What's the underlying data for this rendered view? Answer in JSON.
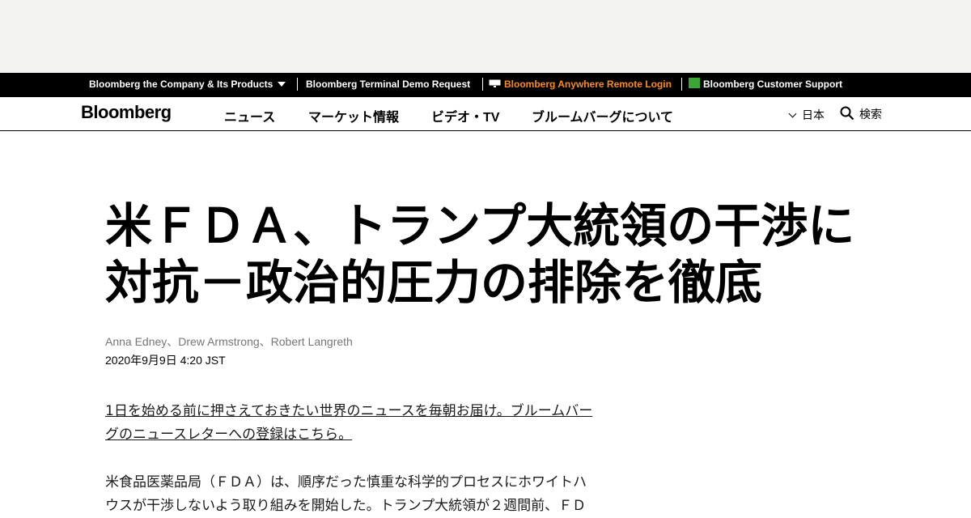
{
  "corporate_bar": {
    "company": "Bloomberg the Company & Its Products",
    "terminal_demo": "Bloomberg Terminal Demo Request",
    "anywhere": "Bloomberg Anywhere Remote Login",
    "support": "Bloomberg Customer Support",
    "anywhere_color": "#fb8b1e"
  },
  "nav": {
    "logo": "Bloomberg",
    "links": [
      "ニュース",
      "マーケット情報",
      "ビデオ・TV",
      "ブルームバーグについて"
    ],
    "region": "日本",
    "search": "検索"
  },
  "article": {
    "headline_line1": "米ＦＤＡ、トランプ大統領の干渉に",
    "headline_line2": "対抗－政治的圧力の排除を徹底",
    "authors": "Anna Edney、Drew Armstrong、Robert Langreth",
    "timestamp": "2020年9月9日 4:20 JST",
    "promo_line1": "1日を始める前に押さえておきたい世界のニュースを毎朝お届け。ブルームバー",
    "promo_line2": "グのニュースレターへの登録はこちら。",
    "body_line1": "米食品医薬品局（ＦＤＡ）は、順序だった慎重な科学的プロセスにホワイトハ",
    "body_line2": "ウスが干渉しないよう取り組みを開始した。トランプ大統領が２週間前、ＦＤ"
  }
}
